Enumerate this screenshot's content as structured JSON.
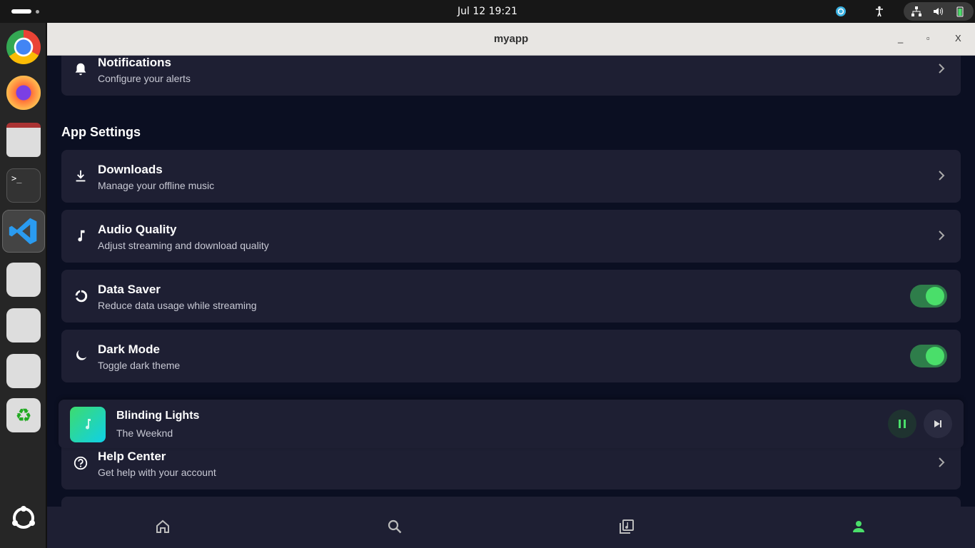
{
  "system": {
    "clock": "Jul 12  19:21"
  },
  "window": {
    "title": "myapp",
    "minimize": "_",
    "maximize": "▫",
    "close": "X"
  },
  "settings": {
    "top_card": {
      "title": "Notifications",
      "subtitle": "Configure your alerts",
      "icon": "bell-icon"
    },
    "app_settings_heading": "App Settings",
    "items": [
      {
        "title": "Downloads",
        "subtitle": "Manage your offline music",
        "icon": "download-icon",
        "type": "link"
      },
      {
        "title": "Audio Quality",
        "subtitle": "Adjust streaming and download quality",
        "icon": "music-note-icon",
        "type": "link"
      },
      {
        "title": "Data Saver",
        "subtitle": "Reduce data usage while streaming",
        "icon": "data-saver-icon",
        "type": "toggle",
        "on": true
      },
      {
        "title": "Dark Mode",
        "subtitle": "Toggle dark theme",
        "icon": "moon-icon",
        "type": "toggle",
        "on": true
      }
    ],
    "help": {
      "title": "Help Center",
      "subtitle": "Get help with your account",
      "icon": "help-icon"
    }
  },
  "player": {
    "title": "Blinding Lights",
    "artist": "The Weeknd",
    "state": "playing"
  },
  "nav": {
    "items": [
      "home",
      "search",
      "library",
      "profile"
    ],
    "active": "profile"
  },
  "colors": {
    "accent": "#4ade6a",
    "card": "#1e1f33",
    "background": "#0b0f22"
  }
}
